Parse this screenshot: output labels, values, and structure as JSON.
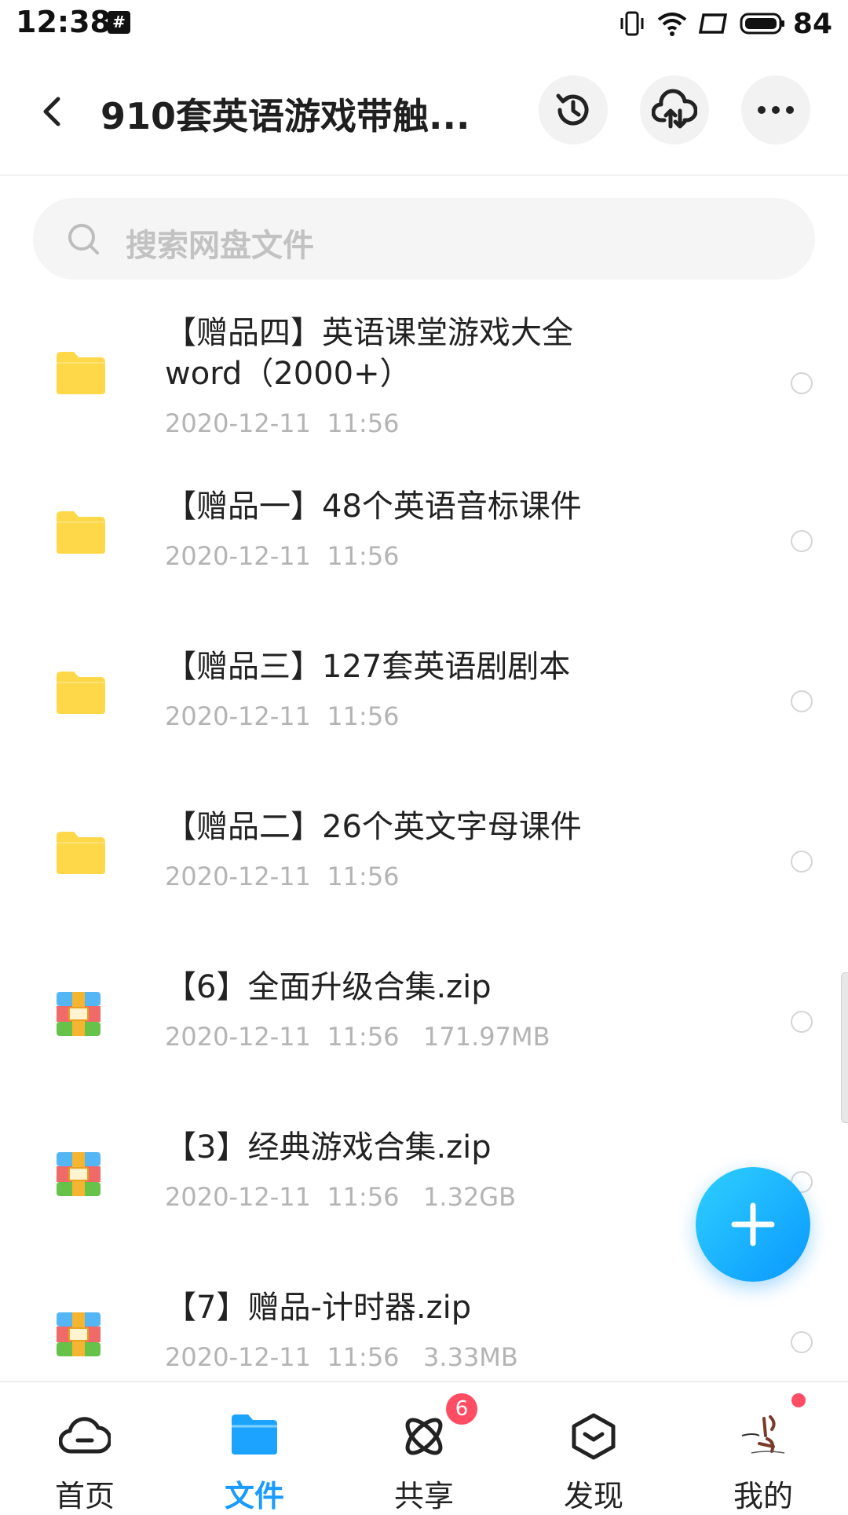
{
  "status_bar": {
    "time": "12:38",
    "grid_icon_glyph": "#",
    "battery": "84"
  },
  "header": {
    "title": "910套英语游戏带触..."
  },
  "search": {
    "placeholder": "搜索网盘文件"
  },
  "files": [
    {
      "type": "folder",
      "name": "【赠品四】英语课堂游戏大全word（2000+）",
      "date": "2020-12-11  11:56",
      "size": ""
    },
    {
      "type": "folder",
      "name": "【赠品一】48个英语音标课件",
      "date": "2020-12-11  11:56",
      "size": ""
    },
    {
      "type": "folder",
      "name": "【赠品三】127套英语剧剧本",
      "date": "2020-12-11  11:56",
      "size": ""
    },
    {
      "type": "folder",
      "name": "【赠品二】26个英文字母课件",
      "date": "2020-12-11  11:56",
      "size": ""
    },
    {
      "type": "zip",
      "name": "【6】全面升级合集.zip",
      "date": "2020-12-11  11:56",
      "size": "171.97MB"
    },
    {
      "type": "zip",
      "name": "【3】经典游戏合集.zip",
      "date": "2020-12-11  11:56",
      "size": "1.32GB"
    },
    {
      "type": "zip",
      "name": "【7】赠品-计时器.zip",
      "date": "2020-12-11  11:56",
      "size": "3.33MB"
    }
  ],
  "nav": {
    "home": "首页",
    "files": "文件",
    "share": "共享",
    "discover": "发现",
    "mine": "我的",
    "share_badge": "6"
  },
  "colors": {
    "accent": "#1a9bff",
    "folder": "#ffd84a",
    "badge": "#ff4d64"
  }
}
